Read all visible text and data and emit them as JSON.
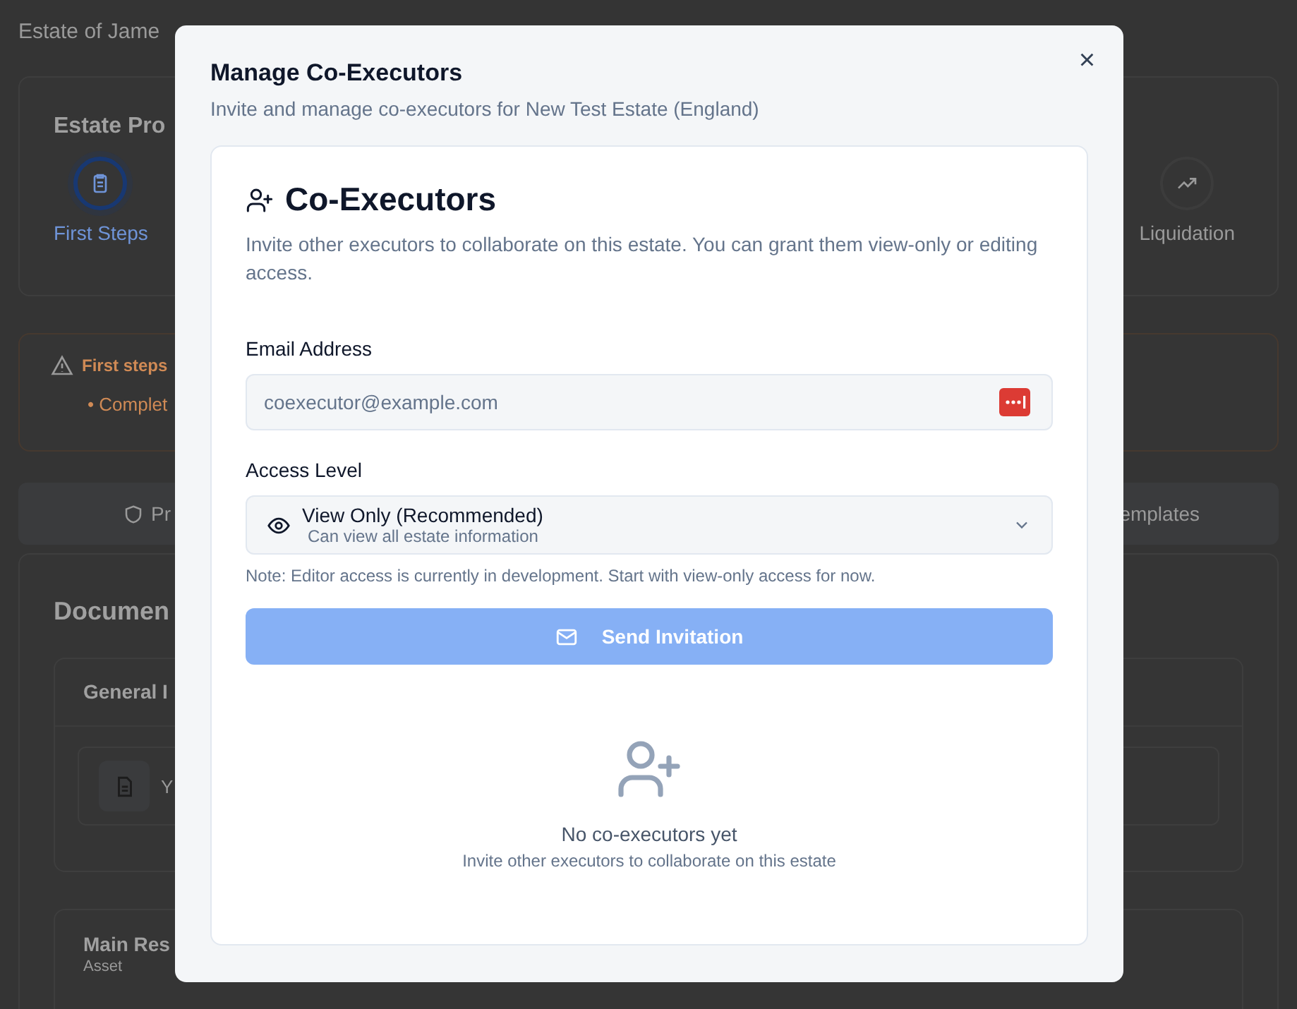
{
  "background": {
    "page_title": "Estate of Jame",
    "progress": {
      "title": "Estate Pro",
      "steps": [
        {
          "label": "First Steps",
          "selected": true
        },
        {
          "label": "Liquidation",
          "selected": false
        }
      ]
    },
    "alert": {
      "title": "First steps",
      "item": "• Complet"
    },
    "tabs": [
      {
        "label": "Pr"
      },
      {
        "label": "emplates"
      }
    ],
    "documents": {
      "title": "Documen",
      "groups": [
        {
          "title": "General I",
          "row": "Y"
        },
        {
          "title": "Main Res",
          "subtitle": "Asset"
        }
      ]
    }
  },
  "dialog": {
    "title": "Manage Co-Executors",
    "subtitle": "Invite and manage co-executors for New Test Estate (England)",
    "close": "×",
    "card": {
      "title": "Co-Executors",
      "description": "Invite other executors to collaborate on this estate. You can grant them view-only or editing access.",
      "email": {
        "label": "Email Address",
        "placeholder": "coexecutor@example.com"
      },
      "access": {
        "label": "Access Level",
        "value": "View Only (Recommended)",
        "hint": "Can view all estate information"
      },
      "note": "Note: Editor access is currently in development. Start with view-only access for now.",
      "button": {
        "label": "Send Invitation",
        "disabled": true
      },
      "empty": {
        "title": "No co-executors yet",
        "text": "Invite other executors to collaborate on this estate"
      }
    }
  }
}
